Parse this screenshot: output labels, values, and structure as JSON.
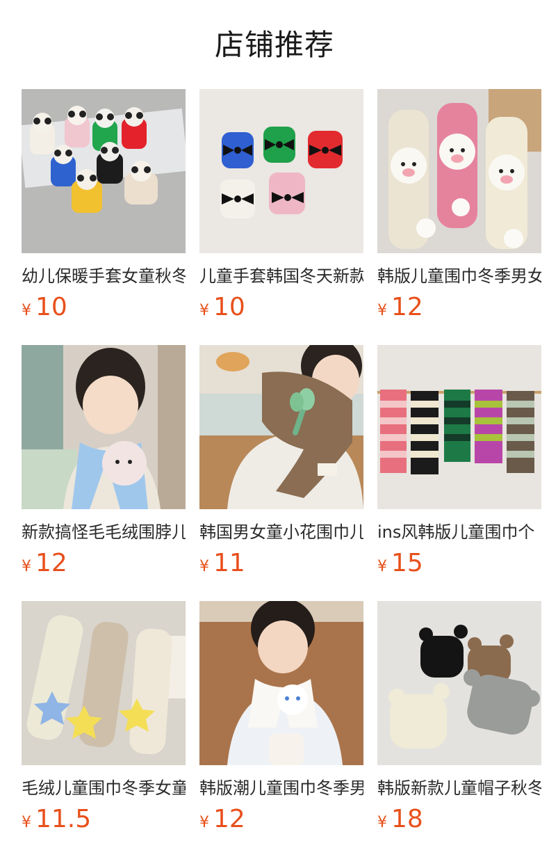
{
  "header": {
    "title": "店铺推荐"
  },
  "currency": "¥",
  "products": [
    {
      "name": "幼儿保暖手套女童秋冬",
      "price": "10",
      "image": "panda-gloves-photo"
    },
    {
      "name": "儿童手套韩国冬天新款",
      "price": "10",
      "image": "bow-gloves-photo"
    },
    {
      "name": "韩版儿童围巾冬季男女",
      "price": "12",
      "image": "sheep-scarves-photo"
    },
    {
      "name": "新款搞怪毛毛绒围脖儿",
      "price": "12",
      "image": "boy-blue-scarf-photo"
    },
    {
      "name": "韩国男女童小花围巾儿",
      "price": "11",
      "image": "boy-flower-scarf-photo"
    },
    {
      "name": "ins风韩版儿童围巾个",
      "price": "15",
      "image": "striped-scarves-photo"
    },
    {
      "name": "毛绒儿童围巾冬季女童",
      "price": "11.5",
      "image": "star-scarves-photo"
    },
    {
      "name": "韩版潮儿童围巾冬季男",
      "price": "12",
      "image": "boy-white-scarf-photo"
    },
    {
      "name": "韩版新款儿童帽子秋冬",
      "price": "18",
      "image": "knit-hats-photo"
    }
  ]
}
